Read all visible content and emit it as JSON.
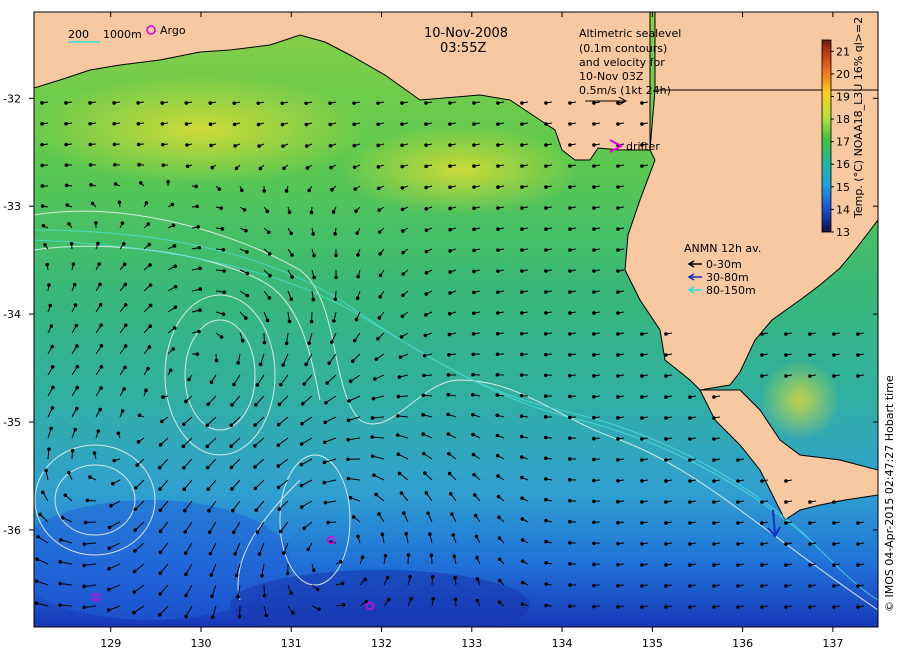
{
  "title": {
    "date": "10-Nov-2008",
    "time": "03:55Z"
  },
  "scale_bar": {
    "label_a": "200",
    "label_b": "1000m"
  },
  "argo_legend": {
    "label": "Argo",
    "color": "#e000e0"
  },
  "altimetry_note": {
    "line1": "Altimetric sealevel",
    "line2": "(0.1m contours)",
    "line3": "and velocity for",
    "line4": "10-Nov 03Z",
    "line5": "0.5m/s (1kt 24h)"
  },
  "drifter_legend": {
    "label": "drifter",
    "color": "#e000e0"
  },
  "anmn_legend": {
    "title": "ANMN 12h av.",
    "items": [
      {
        "label": "0-30m",
        "color": "#000000"
      },
      {
        "label": "30-80m",
        "color": "#1030c0"
      },
      {
        "label": "80-150m",
        "color": "#30e0e0"
      }
    ]
  },
  "colorbar": {
    "title": "Temp. (°C) NOAA18_L3U 16% ql>=2",
    "ticks": [
      "21",
      "20",
      "19",
      "18",
      "17",
      "16",
      "15",
      "14",
      "13"
    ],
    "min": 13,
    "max": 21.5
  },
  "credit": "© IMOS 04-Apr-2015 02:47:27 Hobart time",
  "axes": {
    "x_ticks": [
      "129",
      "130",
      "131",
      "132",
      "133",
      "134",
      "135",
      "136",
      "137"
    ],
    "y_ticks": [
      "-32",
      "-33",
      "-34",
      "-35",
      "-36"
    ],
    "lon_range": [
      128.15,
      137.5
    ],
    "lat_range": [
      -31.2,
      -36.9
    ]
  },
  "colors": {
    "land": "#f8c8a0",
    "frame": "#000000",
    "contour": "#e6f0f0",
    "isobath": "#50e0e0",
    "argo": "#e000e0"
  }
}
